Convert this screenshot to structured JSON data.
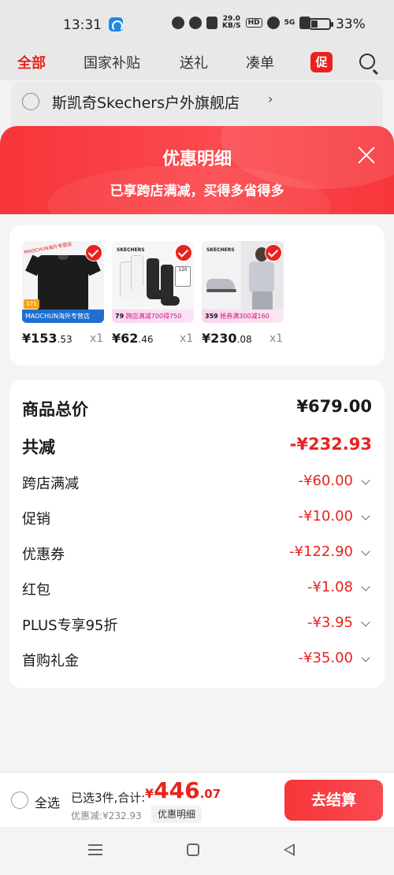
{
  "status_bar": {
    "time": "13:31",
    "speed_value": "29.0",
    "speed_unit": "KB/S",
    "hd": "HD",
    "network": "5G",
    "battery_percent": "33%",
    "battery_level": 0.33
  },
  "tabs": [
    {
      "label": "全部",
      "active": true
    },
    {
      "label": "国家补贴",
      "active": false
    },
    {
      "label": "送礼",
      "active": false
    },
    {
      "label": "凑单",
      "active": false
    }
  ],
  "promo_tab": "促",
  "store": {
    "name": "斯凯奇Skechers户外旗舰店",
    "chevron": "›"
  },
  "panel": {
    "title": "优惠明细",
    "subtitle": "已享跨店满减，买得多省得多"
  },
  "products": [
    {
      "price_int": "¥153",
      "price_dec": ".53",
      "qty": "x1",
      "image_label": "MAOCHUN海外专营店",
      "badge": "171",
      "tag_text": "MAOCHUN海外专营店",
      "icon": "tshirt-icon"
    },
    {
      "price_int": "¥62",
      "price_dec": ".46",
      "qty": "x1",
      "brand": "SKECHERS",
      "box": "120",
      "tag_price": "79",
      "tag_text": "跨店满减700得750",
      "icon": "socks-icon"
    },
    {
      "price_int": "¥230",
      "price_dec": ".08",
      "qty": "x1",
      "brand": "SKECHERS",
      "tag_price": "359",
      "tag_text": "抢券满300减160",
      "icon": "sneaker-icon"
    }
  ],
  "summary": {
    "total_label": "商品总价",
    "total_value": "¥679.00",
    "reduced_label": "共减",
    "reduced_value": "-¥232.93",
    "items": [
      {
        "label": "跨店满减",
        "value": "-¥60.00"
      },
      {
        "label": "促销",
        "value": "-¥10.00"
      },
      {
        "label": "优惠券",
        "value": "-¥122.90"
      },
      {
        "label": "红包",
        "value": "-¥1.08"
      },
      {
        "label": "PLUS专享95折",
        "value": "-¥3.95"
      },
      {
        "label": "首购礼金",
        "value": "-¥35.00"
      }
    ]
  },
  "checkout": {
    "select_all": "全选",
    "selected_text": "已选3件,合计:",
    "currency": "¥",
    "total_int": "446",
    "total_dec": ".07",
    "discount_text": "优惠减:¥232.93",
    "detail_button": "优惠明细",
    "checkout_button": "去结算"
  },
  "colors": {
    "accent": "#e8231f",
    "header": "#f7353a"
  }
}
